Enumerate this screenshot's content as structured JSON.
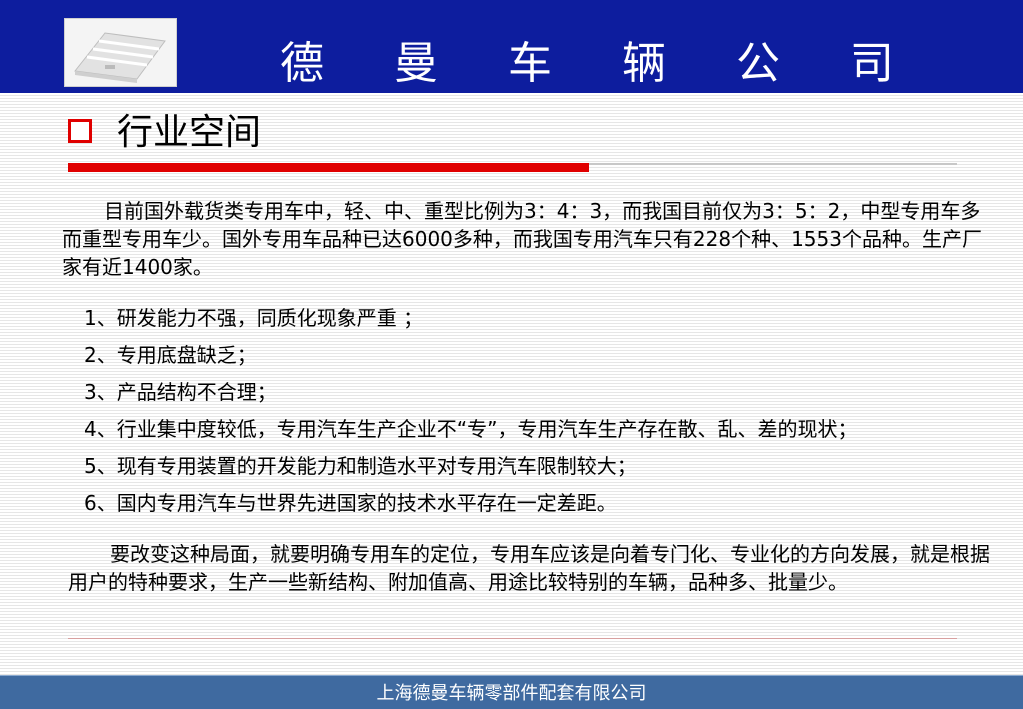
{
  "header": {
    "title": "德 曼 车 辆 公 司"
  },
  "section": {
    "title": "行业空间"
  },
  "intro": "目前国外载货类专用车中，轻、中、重型比例为3：4：3，而我国目前仅为3：5：2，中型专用车多而重型专用车少。国外专用车品种已达6000多种，而我国专用汽车只有228个种、1553个品种。生产厂家有近1400家。",
  "problems": [
    "1、研发能力不强，同质化现象严重 ；",
    "2、专用底盘缺乏；",
    "3、产品结构不合理；",
    "4、行业集中度较低，专用汽车生产企业不“专”，专用汽车生产存在散、乱、差的现状；",
    "5、现有专用装置的开发能力和制造水平对专用汽车限制较大；",
    "6、国内专用汽车与世界先进国家的技术水平存在一定差距。"
  ],
  "conclusion": "要改变这种局面，就要明确专用车的定位，专用车应该是向着专门化、专业化的方向发展，就是根据用户的特种要求，生产一些新结构、附加值高、用途比较特别的车辆，品种多、批量少。",
  "footer": {
    "text": "上海德曼车辆零部件配套有限公司"
  },
  "colors": {
    "header_bg": "#0d1d9e",
    "accent_red": "#e00000",
    "footer_bg": "#3f6aa0"
  },
  "icons": {
    "logo": "company-logo-image",
    "bullet": "square-bullet-icon"
  }
}
